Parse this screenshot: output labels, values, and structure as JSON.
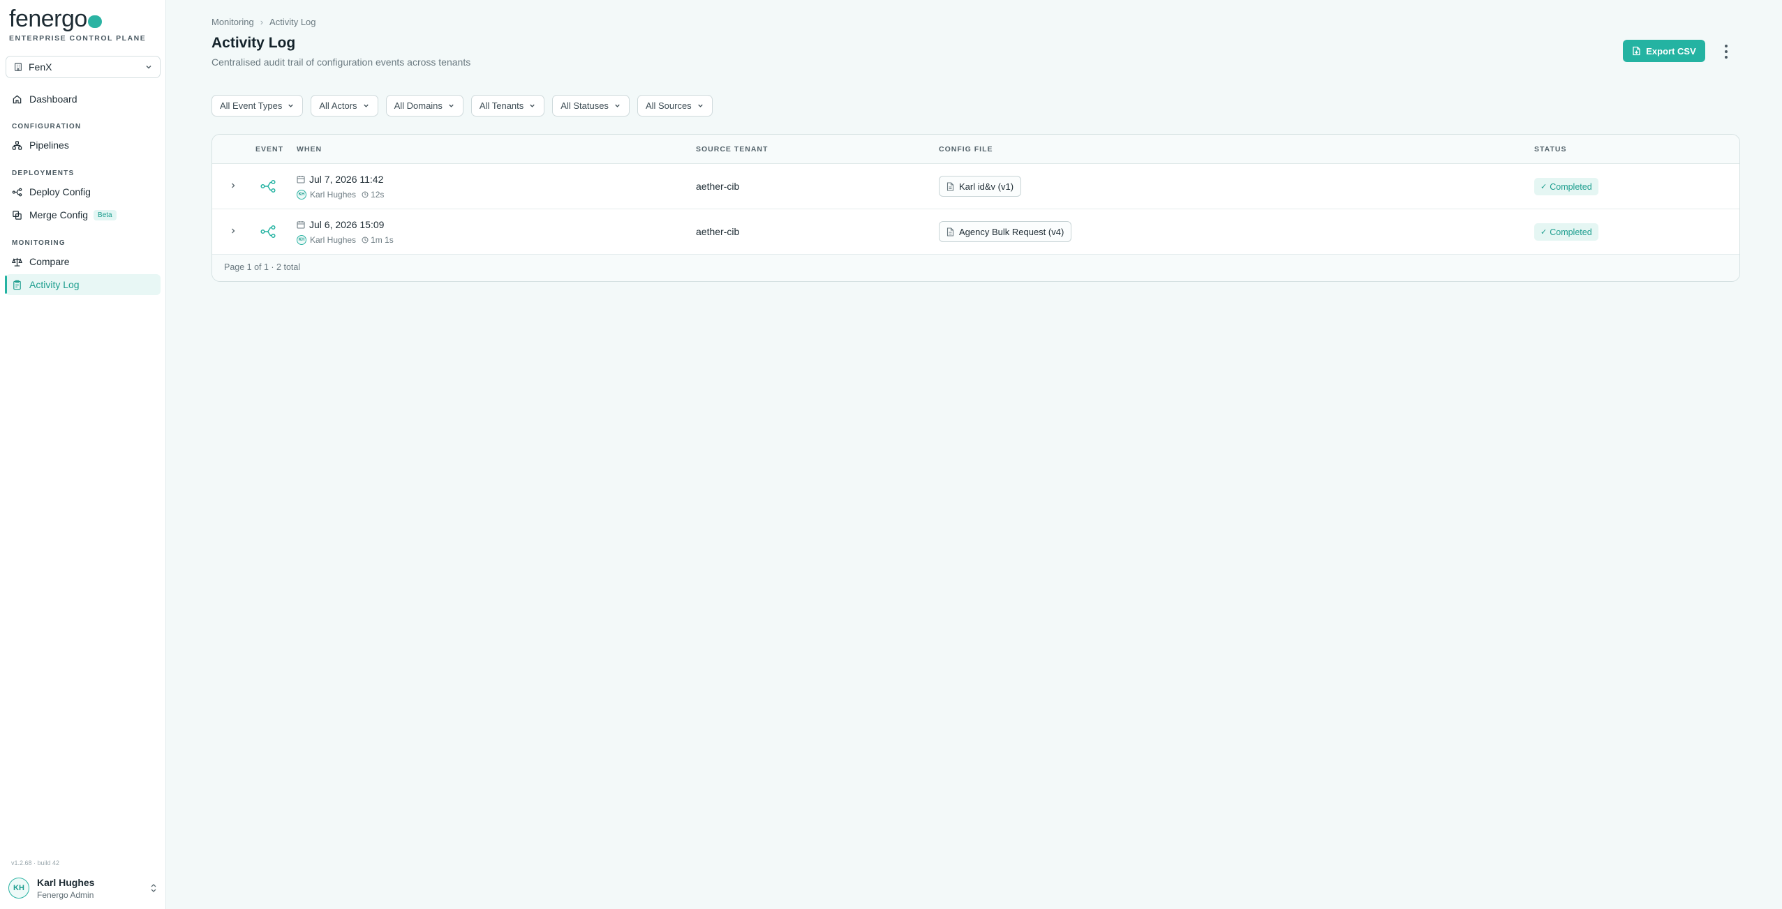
{
  "brand": {
    "name": "fenergo",
    "subtitle": "ENTERPRISE CONTROL PLANE",
    "accent": "#24b3a2"
  },
  "tenant_selector": {
    "value": "FenX"
  },
  "sidebar": {
    "dashboard": "Dashboard",
    "section_configuration": "CONFIGURATION",
    "pipelines": "Pipelines",
    "section_deployments": "DEPLOYMENTS",
    "deploy_config": "Deploy Config",
    "merge_config": "Merge Config",
    "merge_badge": "Beta",
    "section_monitoring": "MONITORING",
    "compare": "Compare",
    "activity_log": "Activity Log"
  },
  "version": "v1.2.68 · build 42",
  "user": {
    "initials": "KH",
    "name": "Karl Hughes",
    "role": "Fenergo Admin"
  },
  "breadcrumb": {
    "parent": "Monitoring",
    "current": "Activity Log"
  },
  "page": {
    "title": "Activity Log",
    "subtitle": "Centralised audit trail of configuration events across tenants",
    "export_label": "Export CSV"
  },
  "filters": [
    "All Event Types",
    "All Actors",
    "All Domains",
    "All Tenants",
    "All Statuses",
    "All Sources"
  ],
  "table": {
    "headers": {
      "event": "EVENT",
      "when": "WHEN",
      "source_tenant": "SOURCE TENANT",
      "config_file": "CONFIG FILE",
      "status": "STATUS"
    },
    "rows": [
      {
        "date": "Jul 7, 2026 11:42",
        "actor_initials": "KH",
        "actor": "Karl Hughes",
        "duration": "12s",
        "tenant": "aether-cib",
        "config_file": "Karl id&v (v1)",
        "status": "Completed"
      },
      {
        "date": "Jul 6, 2026 15:09",
        "actor_initials": "KH",
        "actor": "Karl Hughes",
        "duration": "1m 1s",
        "tenant": "aether-cib",
        "config_file": "Agency Bulk Request (v4)",
        "status": "Completed"
      }
    ],
    "footer": "Page 1 of 1 · 2 total"
  }
}
